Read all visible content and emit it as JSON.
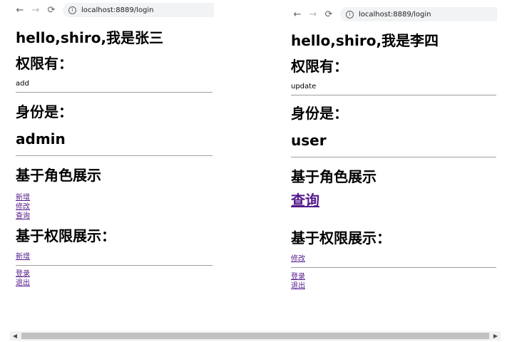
{
  "left": {
    "url": "localhost:8889/login",
    "greeting": "hello,shiro,我是张三",
    "perm_heading": "权限有：",
    "perm_value": "add",
    "identity_heading": "身份是：",
    "identity_value": "admin",
    "role_heading": "基于角色展示",
    "role_links": [
      "新增",
      "修改",
      "查询"
    ],
    "perm_show_heading": "基于权限展示：",
    "perm_links": [
      "新增"
    ],
    "login_link": "登录",
    "logout_link": "退出"
  },
  "right": {
    "url": "localhost:8889/login",
    "greeting": "hello,shiro,我是李四",
    "perm_heading": "权限有：",
    "perm_value": "update",
    "identity_heading": "身份是：",
    "identity_value": "user",
    "role_heading": "基于角色展示",
    "role_links": [
      "查询"
    ],
    "perm_show_heading": "基于权限展示：",
    "perm_links": [
      "修改"
    ],
    "login_link": "登录",
    "logout_link": "退出"
  },
  "icons": {
    "back": "←",
    "forward": "→",
    "reload": "⟳",
    "info": "i",
    "scroll_left": "◀",
    "scroll_right": "▶"
  },
  "colors": {
    "link_visited": "#551a8b",
    "divider": "#9e9e9e"
  }
}
